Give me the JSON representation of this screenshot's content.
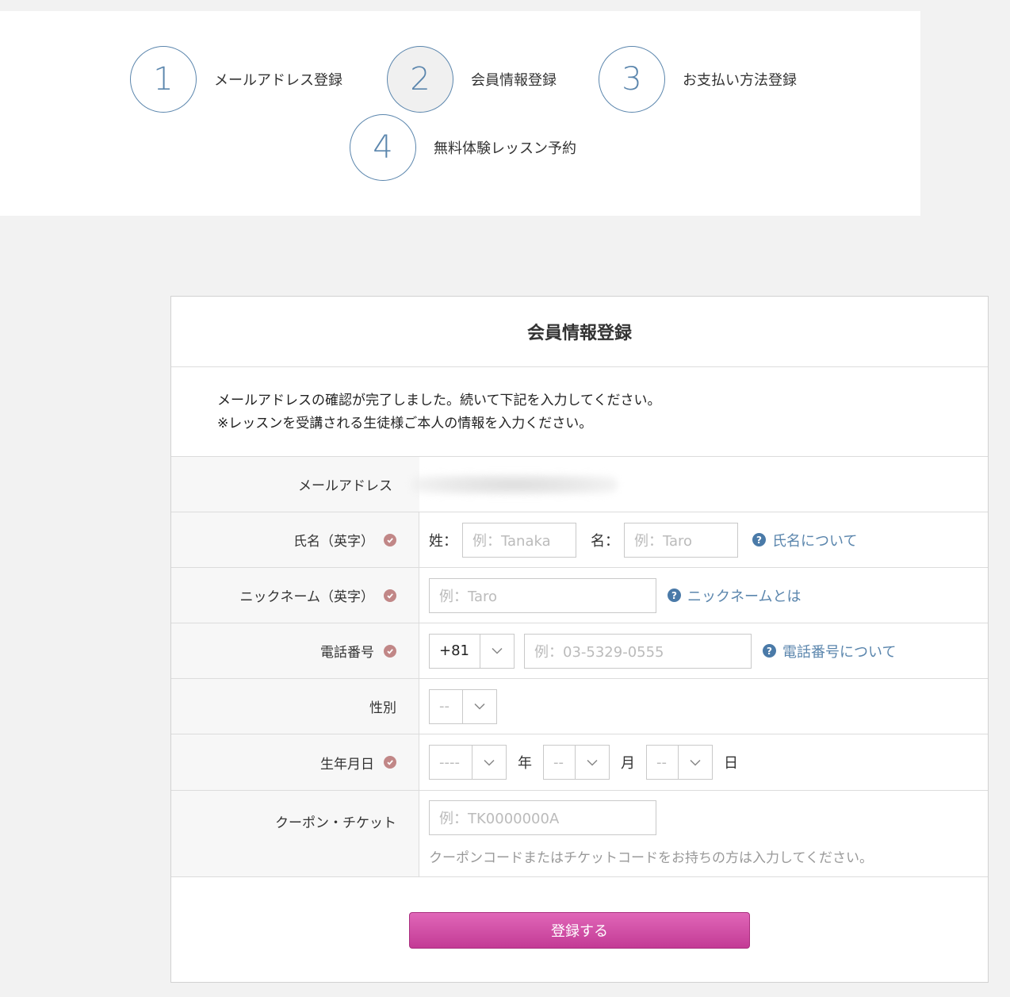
{
  "steps": [
    {
      "number": "1",
      "label": "メールアドレス登録"
    },
    {
      "number": "2",
      "label": "会員情報登録"
    },
    {
      "number": "3",
      "label": "お支払い方法登録"
    },
    {
      "number": "4",
      "label": "無料体験レッスン予約"
    }
  ],
  "form": {
    "title": "会員情報登録",
    "intro_line1": "メールアドレスの確認が完了しました。続いて下記を入力してください。",
    "intro_line2": "※レッスンを受講される生徒様ご本人の情報を入力ください。",
    "email": {
      "label": "メールアドレス"
    },
    "name": {
      "label": "氏名（英字）",
      "last_prefix": "姓：",
      "last_placeholder": "例：Tanaka",
      "first_prefix": "名：",
      "first_placeholder": "例：Taro",
      "help_text": "氏名について"
    },
    "nickname": {
      "label": "ニックネーム（英字）",
      "placeholder": "例：Taro",
      "help_text": "ニックネームとは"
    },
    "phone": {
      "label": "電話番号",
      "country_code": "+81",
      "placeholder": "例：03-5329-0555",
      "help_text": "電話番号について"
    },
    "gender": {
      "label": "性別",
      "value": "--"
    },
    "birthday": {
      "label": "生年月日",
      "year_value": "----",
      "year_unit": "年",
      "month_value": "--",
      "month_unit": "月",
      "day_value": "--",
      "day_unit": "日"
    },
    "coupon": {
      "label": "クーポン・チケット",
      "placeholder": "例：TK0000000A",
      "hint": "クーポンコードまたはチケットコードをお持ちの方は入力してください。"
    },
    "submit_label": "登録する"
  },
  "colors": {
    "accent": "#5b86ad",
    "required_badge": "#c18787",
    "submit": "#c33a95"
  },
  "icons": {
    "required": "check-circle-icon",
    "help": "question-circle-icon",
    "dropdown": "chevron-down-icon"
  }
}
